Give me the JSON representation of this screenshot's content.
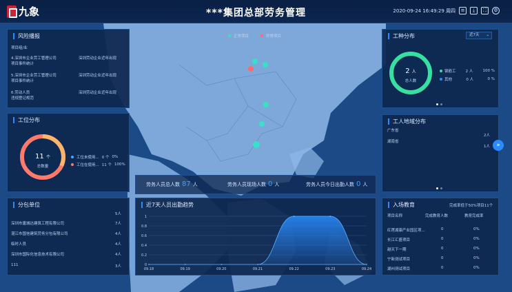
{
  "header": {
    "brand": "九象",
    "title": "***集团总部劳务管理",
    "datetime": "2020-09-24 16:49:29 周四"
  },
  "map": {
    "legend": {
      "normal": {
        "label": "正常项目",
        "color": "#37e0c8"
      },
      "abnormal": {
        "label": "异常项目",
        "color": "#ff6a6a"
      }
    }
  },
  "risk": {
    "title": "风险播报",
    "rows": [
      {
        "left": "项目组/业",
        "right": ""
      },
      {
        "left": "4.深圳市企业劳工管理公司",
        "right": "深圳劳动企业近年出现"
      },
      {
        "left": "项目事件统计",
        "right": ""
      },
      {
        "left": "5.深圳市企业劳工管理公司",
        "right": "深圳劳动企业近年出现"
      },
      {
        "left": "项目事件统计",
        "right": ""
      },
      {
        "left": "6.劳动人员",
        "right": "深圳劳动企业近年出现"
      },
      {
        "left": "违规登记规范",
        "right": ""
      }
    ]
  },
  "worktype": {
    "title": "工位分布",
    "center_value": "11",
    "center_unit": "个",
    "center_label": "总数量",
    "legend": [
      {
        "label": "工位未使用...",
        "count": "0 个",
        "pct": "0%",
        "color": "#4da3ff"
      },
      {
        "label": "工位在使用...",
        "count": "11 个",
        "pct": "100%",
        "color": "#ff7a6b"
      }
    ]
  },
  "subcontract": {
    "title": "分包单位",
    "rows": [
      {
        "name": "",
        "value": "5人"
      },
      {
        "name": "深圳市唐城达建筑工程有限公司",
        "value": "7人"
      },
      {
        "name": "湛江市国信建筑劳务分包有限公司",
        "value": "4人"
      },
      {
        "name": "临时人员",
        "value": "4人"
      },
      {
        "name": "深圳市国际化信息技术有限公司",
        "value": "4人"
      },
      {
        "name": "111",
        "value": "3人"
      }
    ]
  },
  "stats": {
    "total": {
      "label": "劳务人员总人数",
      "value": "87",
      "unit": "人"
    },
    "onsite": {
      "label": "劳务人员现场人数",
      "value": "0",
      "unit": "人"
    },
    "today": {
      "label": "劳务人员今日出勤人数",
      "value": "0",
      "unit": "人"
    }
  },
  "attendance": {
    "title": "近7天人员出勤趋势"
  },
  "trade": {
    "title": "工种分布",
    "select": "近7天",
    "center_value": "2",
    "center_unit": "人",
    "center_label": "总人数",
    "legend": [
      {
        "label": "钢筋工",
        "count": "2 人",
        "pct": "100 %",
        "color": "#37e0a0"
      },
      {
        "label": "其他",
        "count": "0 人",
        "pct": "0 %",
        "color": "#2b8cff"
      }
    ]
  },
  "region": {
    "title": "工人地域分布",
    "rows": [
      {
        "name": "广东省",
        "value": "2人"
      },
      {
        "name": "湖南省",
        "value": "1人"
      }
    ]
  },
  "training": {
    "title": "入场教育",
    "summary": "完成率低于50%项目11个",
    "headers": [
      "项目名称",
      "完成教育人数",
      "教育完成率"
    ],
    "rows": [
      {
        "name": "红莲湖康产业园区项...",
        "count": "0",
        "pct": "0%"
      },
      {
        "name": "长江汇盛项目",
        "count": "0",
        "pct": "0%"
      },
      {
        "name": "越天下一期",
        "count": "0",
        "pct": "0%"
      },
      {
        "name": "宁新测试项目",
        "count": "0",
        "pct": "0%"
      },
      {
        "name": "湖州测试项目",
        "count": "0",
        "pct": "0%"
      }
    ]
  },
  "chart_data": {
    "type": "area",
    "title": "近7天人员出勤趋势",
    "categories": [
      "09.18",
      "09.19",
      "09.20",
      "09.21",
      "09.22",
      "09.23",
      "09.24"
    ],
    "values": [
      0,
      0,
      0,
      0,
      1,
      1,
      0
    ],
    "yticks": [
      "0",
      "0.2",
      "0.4",
      "0.6",
      "0.8",
      "1"
    ],
    "ylim": [
      0,
      1
    ],
    "color": "#2b8cff"
  }
}
